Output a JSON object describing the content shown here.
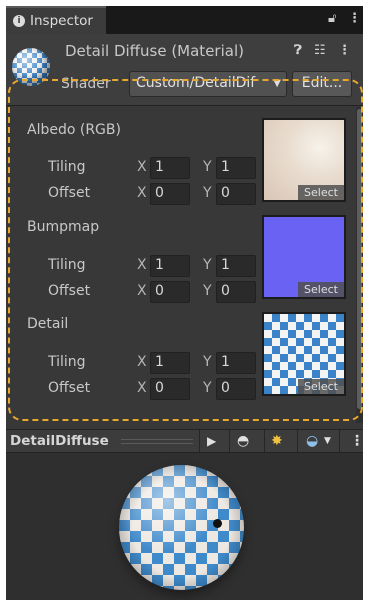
{
  "tab": {
    "title": "Inspector"
  },
  "header": {
    "material_name": "Detail Diffuse (Material)",
    "shader_label": "Shader",
    "shader_value": "Custom/DetailDif",
    "edit_label": "Edit..."
  },
  "properties": [
    {
      "title": "Albedo (RGB)",
      "tiling_label": "Tiling",
      "offset_label": "Offset",
      "tiling_x": "1",
      "tiling_y": "1",
      "offset_x": "0",
      "offset_y": "0"
    },
    {
      "title": "Bumpmap",
      "tiling_label": "Tiling",
      "offset_label": "Offset",
      "tiling_x": "1",
      "tiling_y": "1",
      "offset_x": "0",
      "offset_y": "0"
    },
    {
      "title": "Detail",
      "tiling_label": "Tiling",
      "offset_label": "Offset",
      "tiling_x": "1",
      "tiling_y": "1",
      "offset_x": "0",
      "offset_y": "0"
    }
  ],
  "axis": {
    "x": "X",
    "y": "Y"
  },
  "select_label": "Select",
  "preview": {
    "name": "DetailDiffuse"
  },
  "colors": {
    "highlight": "#e8a92a",
    "bumpmap": "#6a62f2",
    "checker_blue": "#3b83c8"
  }
}
